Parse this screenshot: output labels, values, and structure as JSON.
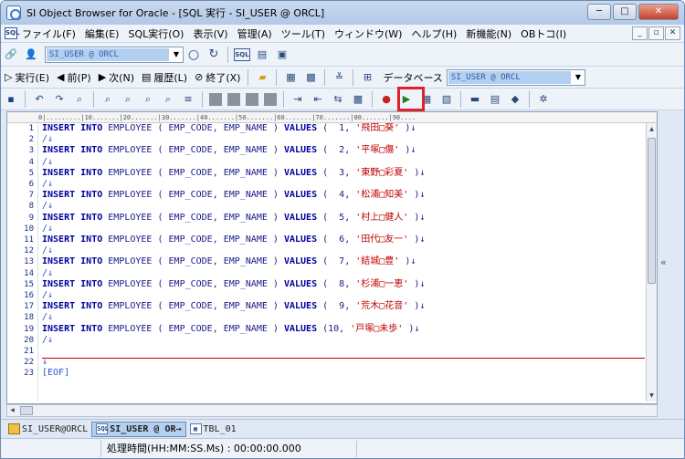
{
  "window": {
    "title": "SI Object Browser for Oracle - [SQL 実行 - SI_USER @ ORCL]",
    "min": "─",
    "max": "□",
    "close": "✕"
  },
  "menu": {
    "items": [
      "ファイル(F)",
      "編集(E)",
      "SQL実行(O)",
      "表示(V)",
      "管理(A)",
      "ツール(T)",
      "ウィンドウ(W)",
      "ヘルプ(H)",
      "新機能(N)",
      "OBトコ(I)"
    ],
    "icon_label": "SQL",
    "mdi": [
      "_",
      "▫",
      "✕"
    ]
  },
  "toolbar1": {
    "connection": "SI_USER @ ORCL",
    "sql_icon_label": "SQL"
  },
  "toolbar2": {
    "run": "実行(E)",
    "prev": "前(P)",
    "next": "次(N)",
    "history": "履歴(L)",
    "stop": "終了(X)",
    "db_label": "データベース",
    "db_value": "SI_USER @ ORCL"
  },
  "ruler": "0|.........|10.......|20.......|30.......|40.......|50.......|60.......|70.......|80.......|90....",
  "editor": {
    "lines": [
      {
        "n": "1",
        "code": [
          "INSERT",
          "INTO",
          "EMPLOYEE",
          "( EMP_CODE, EMP_NAME )",
          "VALUES",
          "(  1,",
          "'飛田□葵'",
          ")↓"
        ]
      },
      {
        "n": "2",
        "slash": "/↓"
      },
      {
        "n": "3",
        "code": [
          "INSERT",
          "INTO",
          "EMPLOYEE",
          "( EMP_CODE, EMP_NAME )",
          "VALUES",
          "(  2,",
          "'平塚□傷'",
          ")↓"
        ]
      },
      {
        "n": "4",
        "slash": "/↓"
      },
      {
        "n": "5",
        "code": [
          "INSERT",
          "INTO",
          "EMPLOYEE",
          "( EMP_CODE, EMP_NAME )",
          "VALUES",
          "(  3,",
          "'東野□彩夏'",
          ")↓"
        ]
      },
      {
        "n": "6",
        "slash": "/↓"
      },
      {
        "n": "7",
        "code": [
          "INSERT",
          "INTO",
          "EMPLOYEE",
          "( EMP_CODE, EMP_NAME )",
          "VALUES",
          "(  4,",
          "'松浦□知美'",
          ")↓"
        ]
      },
      {
        "n": "8",
        "slash": "/↓"
      },
      {
        "n": "9",
        "code": [
          "INSERT",
          "INTO",
          "EMPLOYEE",
          "( EMP_CODE, EMP_NAME )",
          "VALUES",
          "(  5,",
          "'村上□健人'",
          ")↓"
        ]
      },
      {
        "n": "10",
        "slash": "/↓"
      },
      {
        "n": "11",
        "code": [
          "INSERT",
          "INTO",
          "EMPLOYEE",
          "( EMP_CODE, EMP_NAME )",
          "VALUES",
          "(  6,",
          "'田代□友一'",
          ")↓"
        ]
      },
      {
        "n": "12",
        "slash": "/↓"
      },
      {
        "n": "13",
        "code": [
          "INSERT",
          "INTO",
          "EMPLOYEE",
          "( EMP_CODE, EMP_NAME )",
          "VALUES",
          "(  7,",
          "'結城□豊'",
          ")↓"
        ]
      },
      {
        "n": "14",
        "slash": "/↓"
      },
      {
        "n": "15",
        "code": [
          "INSERT",
          "INTO",
          "EMPLOYEE",
          "( EMP_CODE, EMP_NAME )",
          "VALUES",
          "(  8,",
          "'杉浦□一恵'",
          ")↓"
        ]
      },
      {
        "n": "16",
        "slash": "/↓"
      },
      {
        "n": "17",
        "code": [
          "INSERT",
          "INTO",
          "EMPLOYEE",
          "( EMP_CODE, EMP_NAME )",
          "VALUES",
          "(  9,",
          "'荒木□花音'",
          ")↓"
        ]
      },
      {
        "n": "18",
        "slash": "/↓"
      },
      {
        "n": "19",
        "code": [
          "INSERT",
          "INTO",
          "EMPLOYEE",
          "( EMP_CODE, EMP_NAME )",
          "VALUES",
          "(10,",
          "'戸塚□未歩'",
          ")↓"
        ]
      },
      {
        "n": "20",
        "slash": "/↓"
      },
      {
        "n": "21",
        "slash": ""
      },
      {
        "n": "22",
        "slash": "↓"
      },
      {
        "n": "23",
        "slash": "[EOF]"
      }
    ]
  },
  "tabs": [
    "SI_USER@ORCL",
    "SI_USER @ OR→",
    "TBL_01"
  ],
  "status": {
    "exec_time": "処理時間(HH:MM:SS.Ms) : 00:00:00.000"
  },
  "colors": {
    "keyword": "#0000a0",
    "string": "#c00000",
    "highlight": "#e0202a"
  }
}
